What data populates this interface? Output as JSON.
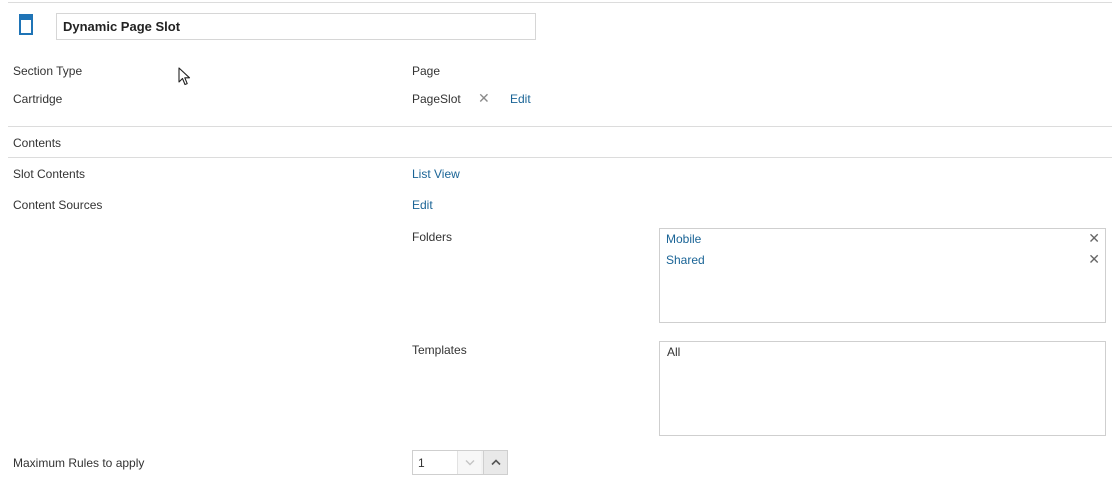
{
  "header": {
    "title_value": "Dynamic Page Slot",
    "icon": "page-icon"
  },
  "fields": {
    "section_type": {
      "label": "Section Type",
      "value": "Page"
    },
    "cartridge": {
      "label": "Cartridge",
      "value": "PageSlot",
      "remove_glyph": "✕",
      "edit_label": "Edit"
    },
    "contents_heading": "Contents",
    "slot_contents": {
      "label": "Slot Contents",
      "link": "List View"
    },
    "content_sources": {
      "label": "Content Sources",
      "link": "Edit"
    },
    "folders": {
      "label": "Folders",
      "items": [
        "Mobile",
        "Shared"
      ],
      "remove_glyph": "✕"
    },
    "templates": {
      "label": "Templates",
      "items": [
        "All"
      ]
    },
    "max_rules": {
      "label": "Maximum Rules to apply",
      "value": "1"
    }
  },
  "colors": {
    "link": "#1a6496",
    "icon_blue": "#1f74b6",
    "divider": "#dcdcdc"
  }
}
